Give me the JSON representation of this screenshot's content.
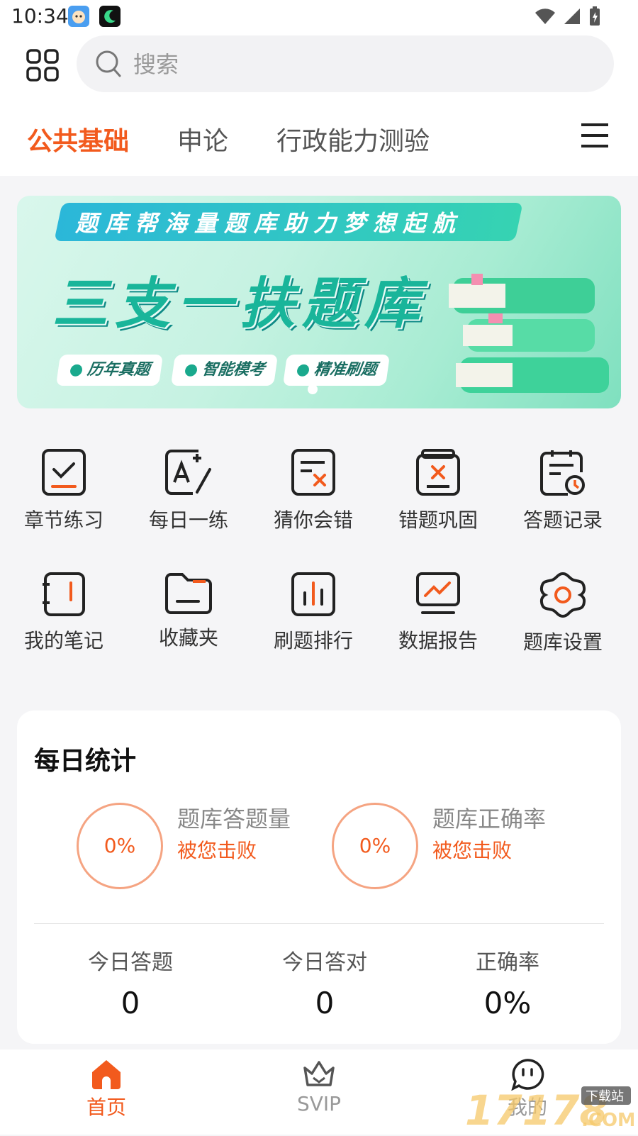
{
  "status_bar": {
    "time": "10:34"
  },
  "search": {
    "placeholder": "搜索"
  },
  "tabs": [
    {
      "label": "公共基础",
      "active": true
    },
    {
      "label": "申论",
      "active": false
    },
    {
      "label": "行政能力测验",
      "active": false
    }
  ],
  "banner": {
    "ribbon_text": "题库帮海量题库助力梦想起航",
    "title": "三支一扶题库",
    "tags": [
      "历年真题",
      "智能模考",
      "精准刷题"
    ]
  },
  "features": [
    {
      "label": "章节练习",
      "icon": "chapter-practice-icon"
    },
    {
      "label": "每日一练",
      "icon": "daily-practice-icon"
    },
    {
      "label": "猜你会错",
      "icon": "guess-wrong-icon"
    },
    {
      "label": "错题巩固",
      "icon": "wrong-review-icon"
    },
    {
      "label": "答题记录",
      "icon": "answer-record-icon"
    },
    {
      "label": "我的笔记",
      "icon": "notes-icon"
    },
    {
      "label": "收藏夹",
      "icon": "folder-icon"
    },
    {
      "label": "刷题排行",
      "icon": "ranking-icon"
    },
    {
      "label": "数据报告",
      "icon": "report-icon"
    },
    {
      "label": "题库设置",
      "icon": "settings-icon"
    }
  ],
  "daily_stats": {
    "title": "每日统计",
    "rings": [
      {
        "value": "0%",
        "label": "题库答题量",
        "sub": "被您击败"
      },
      {
        "value": "0%",
        "label": "题库正确率",
        "sub": "被您击败"
      }
    ],
    "columns": [
      {
        "label": "今日答题",
        "value": "0"
      },
      {
        "label": "今日答对",
        "value": "0"
      },
      {
        "label": "正确率",
        "value": "0%"
      }
    ]
  },
  "bottom_nav": [
    {
      "label": "首页",
      "active": true
    },
    {
      "label": "SVIP",
      "active": false
    },
    {
      "label": "我的",
      "active": false
    }
  ],
  "watermark": "17178.COM 下载站",
  "colors": {
    "accent": "#f25a1d",
    "banner_teal": "#19b59a"
  }
}
